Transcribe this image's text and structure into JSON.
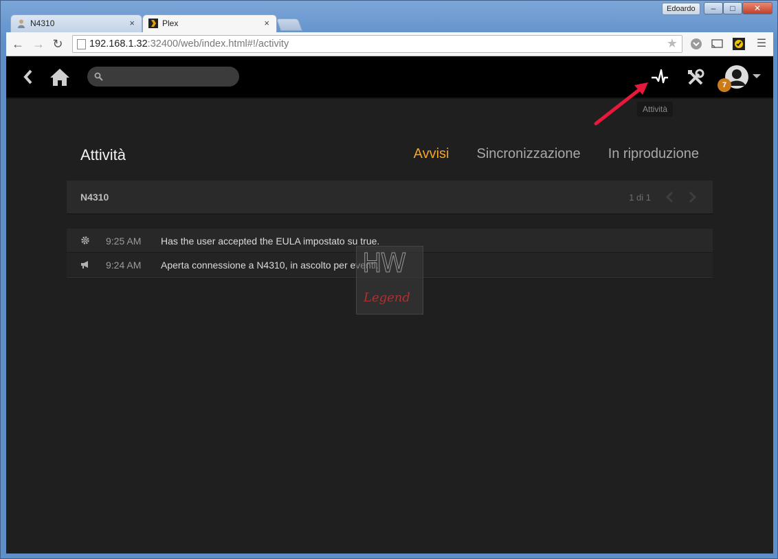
{
  "window": {
    "user": "Edoardo",
    "minimize": "–",
    "maximize": "□",
    "close": "✕"
  },
  "tabs": [
    {
      "label": "N4310",
      "close": "×"
    },
    {
      "label": "Plex",
      "close": "×"
    }
  ],
  "toolbar": {
    "url_host": "192.168.1.32",
    "url_rest": ":32400/web/index.html#!/activity"
  },
  "plex": {
    "tooltip": "Attività",
    "notification_count": "7",
    "page_title": "Attività",
    "nav_tabs": [
      {
        "label": "Avvisi",
        "active": true
      },
      {
        "label": "Sincronizzazione",
        "active": false
      },
      {
        "label": "In riproduzione",
        "active": false
      }
    ],
    "server": {
      "name": "N4310",
      "pager": "1 di 1"
    },
    "events": [
      {
        "icon": "gear-icon",
        "time": "9:25 AM",
        "message": "Has the user accepted the EULA impostato su true."
      },
      {
        "icon": "megaphone-icon",
        "time": "9:24 AM",
        "message": "Aperta connessione a N4310, in ascolto per eventi."
      }
    ],
    "accent_color": "#f2a52a",
    "badge_color": "#cc7b19"
  },
  "watermark": {
    "line1": "HW",
    "line2": "Legend"
  }
}
